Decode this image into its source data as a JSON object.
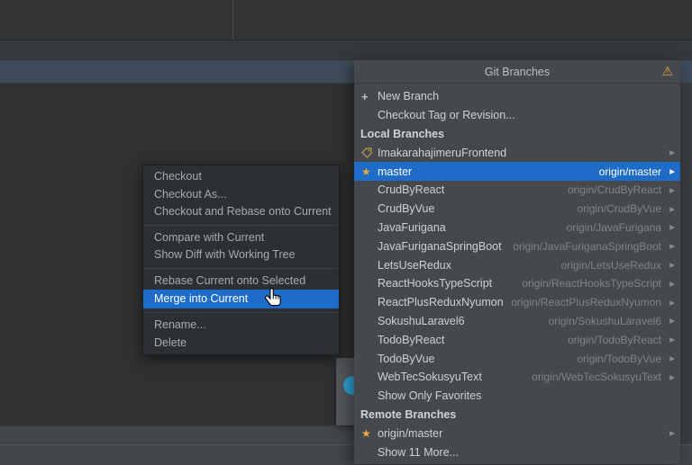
{
  "colors": {
    "selection_blue": "#1e6cc8",
    "star_orange": "#e9aa3f",
    "warning_amber": "#dba24b",
    "popup_bg": "#45494d",
    "menu_bg": "#2d3033"
  },
  "git_popup": {
    "title": "Git Branches",
    "items": [
      {
        "type": "action",
        "icon": "plus-icon",
        "label": "New Branch"
      },
      {
        "type": "action",
        "label": "Checkout Tag or Revision..."
      },
      {
        "type": "section",
        "label": "Local Branches"
      },
      {
        "type": "branch",
        "icon": "tag-icon",
        "label": "ImakarahajimeruFrontend",
        "tracking": "",
        "arrow": true
      },
      {
        "type": "branch",
        "icon": "star-icon",
        "label": "master",
        "tracking": "origin/master",
        "arrow": true,
        "selected": true
      },
      {
        "type": "branch",
        "label": "CrudByReact",
        "tracking": "origin/CrudByReact",
        "arrow": true
      },
      {
        "type": "branch",
        "label": "CrudByVue",
        "tracking": "origin/CrudByVue",
        "arrow": true
      },
      {
        "type": "branch",
        "label": "JavaFurigana",
        "tracking": "origin/JavaFurigana",
        "arrow": true
      },
      {
        "type": "branch",
        "label": "JavaFuriganaSpringBoot",
        "tracking": "origin/JavaFuriganaSpringBoot",
        "arrow": true
      },
      {
        "type": "branch",
        "label": "LetsUseRedux",
        "tracking": "origin/LetsUseRedux",
        "arrow": true
      },
      {
        "type": "branch",
        "label": "ReactHooksTypeScript",
        "tracking": "origin/ReactHooksTypeScript",
        "arrow": true
      },
      {
        "type": "branch",
        "label": "ReactPlusReduxNyumon",
        "tracking": "origin/ReactPlusReduxNyumon",
        "arrow": true
      },
      {
        "type": "branch",
        "label": "SokushuLaravel6",
        "tracking": "origin/SokushuLaravel6",
        "arrow": true
      },
      {
        "type": "branch",
        "label": "TodoByReact",
        "tracking": "origin/TodoByReact",
        "arrow": true
      },
      {
        "type": "branch",
        "label": "TodoByVue",
        "tracking": "origin/TodoByVue",
        "arrow": true
      },
      {
        "type": "branch",
        "label": "WebTecSokusyuText",
        "tracking": "origin/WebTecSokusyuText",
        "arrow": true
      },
      {
        "type": "action",
        "label": "Show Only Favorites"
      },
      {
        "type": "section",
        "label": "Remote Branches"
      },
      {
        "type": "branch",
        "icon": "star-icon",
        "label": "origin/master",
        "tracking": "",
        "arrow": true
      },
      {
        "type": "action",
        "label": "Show 11 More..."
      }
    ]
  },
  "context_menu": {
    "items": [
      {
        "label": "Checkout"
      },
      {
        "label": "Checkout As..."
      },
      {
        "label": "Checkout and Rebase onto Current"
      },
      {
        "type": "separator"
      },
      {
        "label": "Compare with Current"
      },
      {
        "label": "Show Diff with Working Tree"
      },
      {
        "type": "separator"
      },
      {
        "label": "Rebase Current onto Selected"
      },
      {
        "label": "Merge into Current",
        "selected": true
      },
      {
        "type": "separator"
      },
      {
        "label": "Rename..."
      },
      {
        "label": "Delete"
      }
    ]
  }
}
